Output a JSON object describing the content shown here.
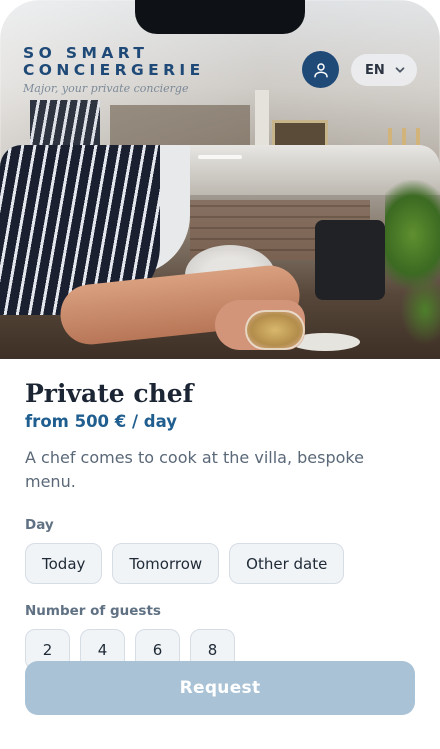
{
  "header": {
    "brand_line1": "SO SMART",
    "brand_line2": "CONCIERGERIE",
    "tagline": "Major, your private concierge",
    "language": "EN",
    "account_icon": "user-icon"
  },
  "service": {
    "title": "Private chef",
    "price": "from 500 € / day",
    "description": "A chef comes to cook at the villa, bespoke menu."
  },
  "day": {
    "label": "Day",
    "options": [
      "Today",
      "Tomorrow",
      "Other date"
    ]
  },
  "guests": {
    "label": "Number of guests",
    "options": [
      "2",
      "4",
      "6",
      "8"
    ]
  },
  "actions": {
    "request_label": "Request"
  },
  "colors": {
    "brand": "#1f4a78",
    "price": "#1f5e8f",
    "request_disabled": "#a9c2d5",
    "chip_bg": "#f1f4f7"
  }
}
